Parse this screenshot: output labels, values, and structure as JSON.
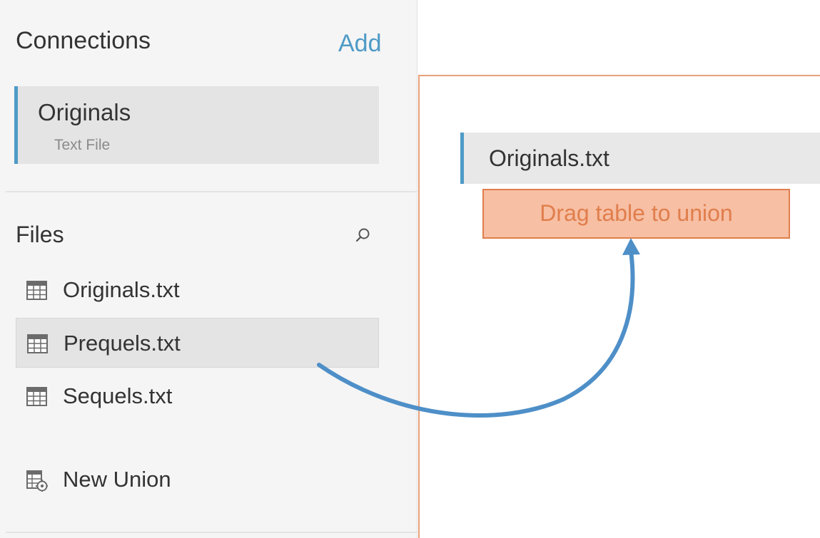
{
  "connections": {
    "header": "Connections",
    "add_label": "Add",
    "items": [
      {
        "name": "Originals",
        "type": "Text File"
      }
    ]
  },
  "files": {
    "header": "Files",
    "search_icon": "search-icon",
    "items": [
      {
        "label": "Originals.txt",
        "icon": "table-icon",
        "selected": false
      },
      {
        "label": "Prequels.txt",
        "icon": "table-icon",
        "selected": true
      },
      {
        "label": "Sequels.txt",
        "icon": "table-icon",
        "selected": false
      },
      {
        "label": "New Union",
        "icon": "new-union-icon",
        "selected": false
      }
    ]
  },
  "canvas": {
    "table_label": "Originals.txt",
    "drop_zone_label": "Drag table to union"
  },
  "colors": {
    "accent_blue": "#4e9ac6",
    "drop_orange": "#e07e4c",
    "drop_fill": "#f7bfa4",
    "sidebar_bg": "#f5f5f5"
  }
}
